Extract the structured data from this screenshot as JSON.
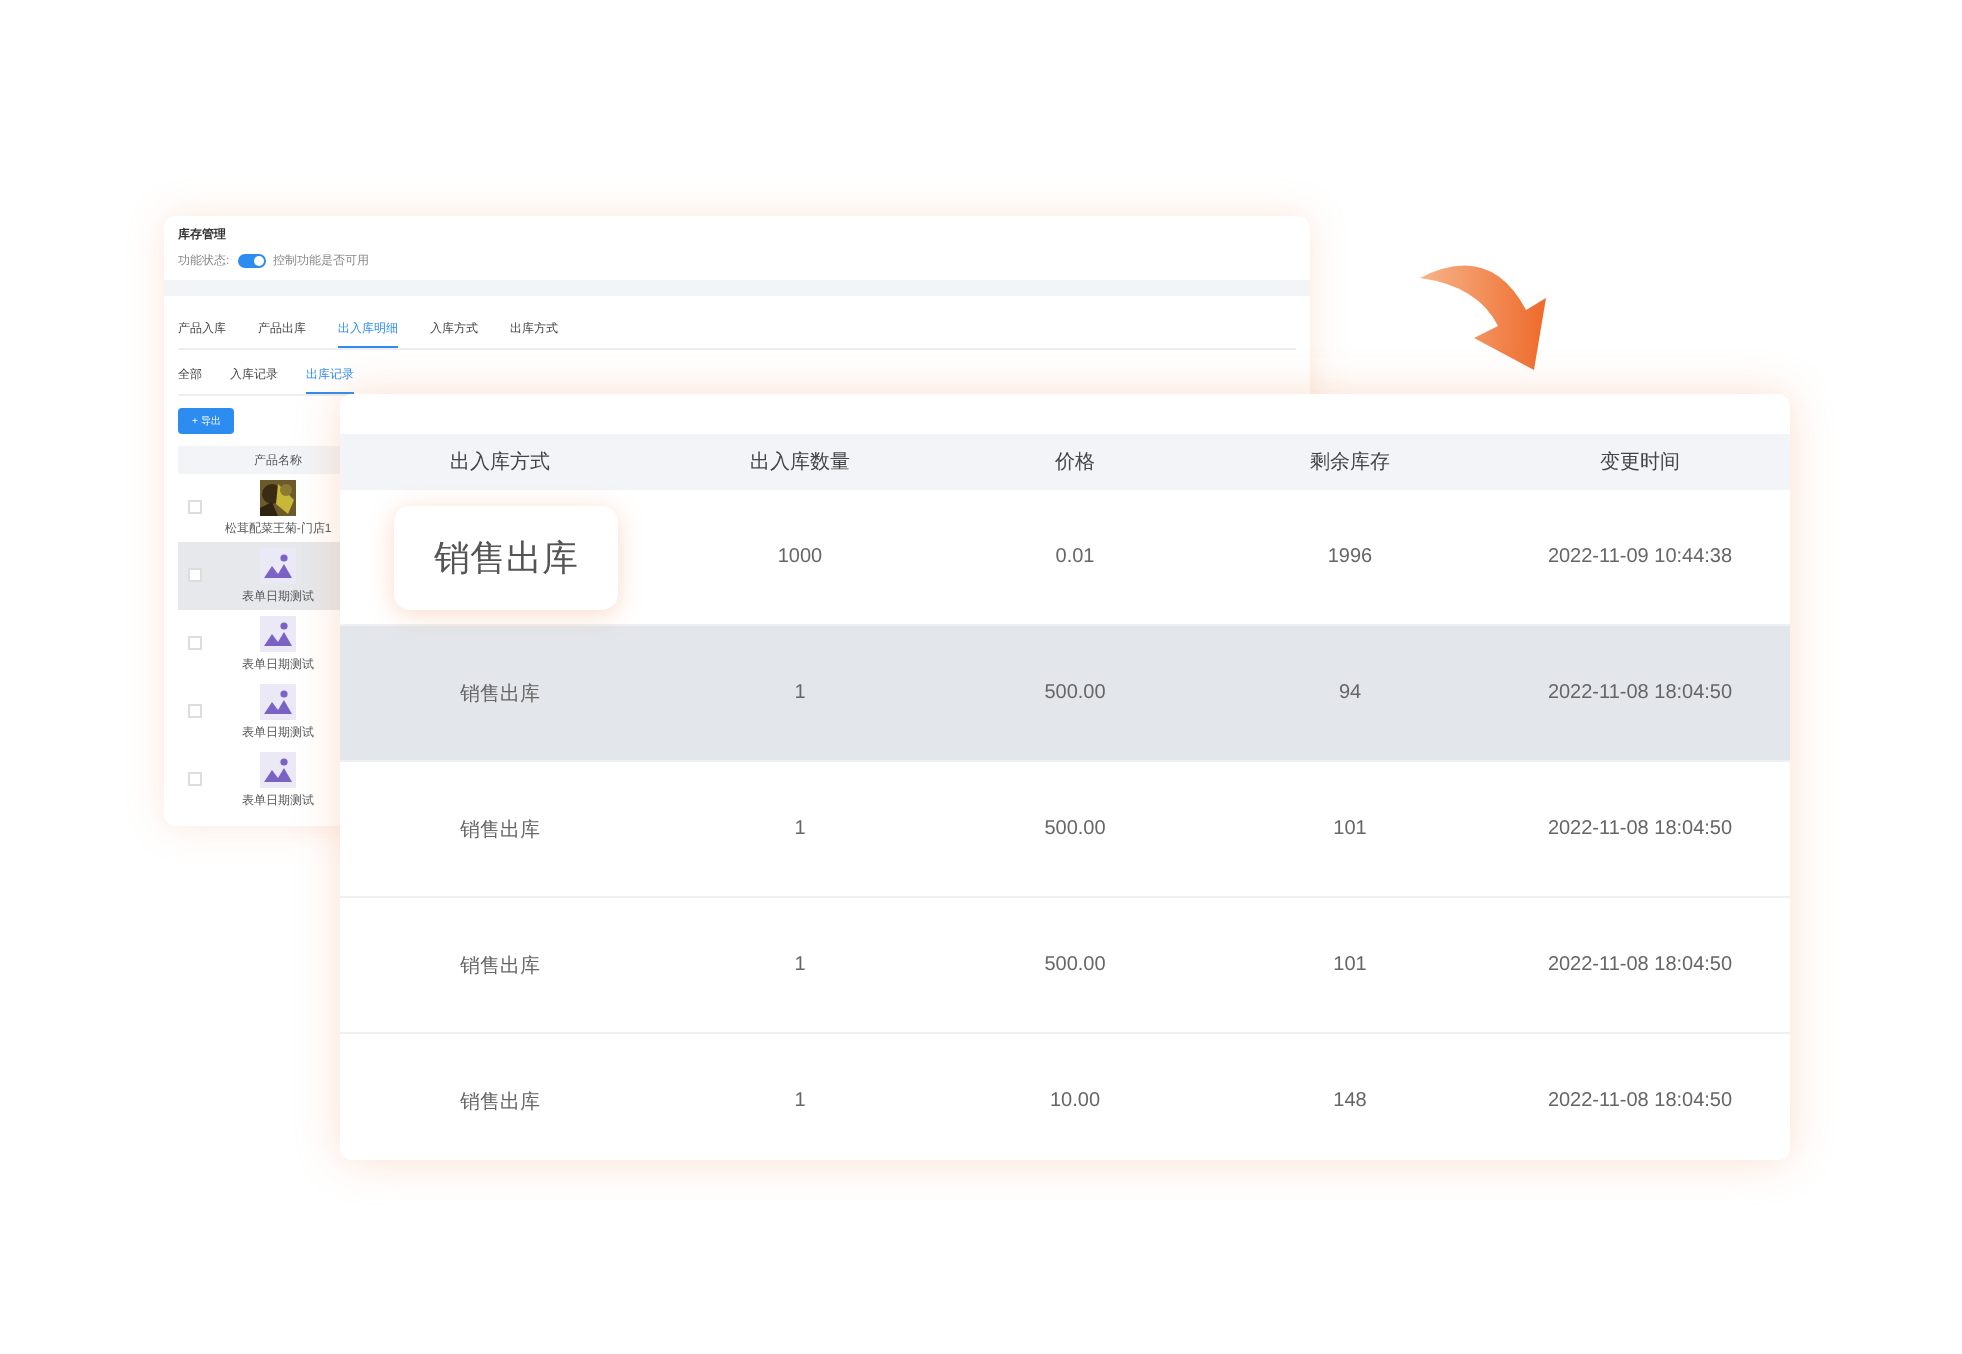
{
  "back_window": {
    "title": "库存管理",
    "status_label": "功能状态:",
    "status_on": true,
    "status_hint": "控制功能是否可用",
    "tabs": [
      {
        "label": "产品入库",
        "selected": false
      },
      {
        "label": "产品出库",
        "selected": false
      },
      {
        "label": "出入库明细",
        "selected": true
      },
      {
        "label": "入库方式",
        "selected": false
      },
      {
        "label": "出库方式",
        "selected": false
      }
    ],
    "subtabs": [
      {
        "label": "全部",
        "selected": false
      },
      {
        "label": "入库记录",
        "selected": false
      },
      {
        "label": "出库记录",
        "selected": true
      }
    ],
    "export_button": "+ 导出",
    "column": "产品名称",
    "rows": [
      {
        "name": "松茸配菜王菊-门店1",
        "highlighted": false
      },
      {
        "kind": "placeholder",
        "name": "表单日期测试",
        "highlighted": true
      },
      {
        "kind": "placeholder",
        "name": "表单日期测试",
        "highlighted": false
      },
      {
        "kind": "placeholder",
        "name": "表单日期测试",
        "highlighted": false
      },
      {
        "kind": "placeholder",
        "name": "表单日期测试",
        "highlighted": false
      }
    ]
  },
  "table": {
    "columns": [
      "出入库方式",
      "出入库数量",
      "价格",
      "剩余库存",
      "变更时间"
    ],
    "rows": [
      {
        "cells": [
          "销售出库",
          "1000",
          "0.01",
          "1996",
          "2022-11-09 10:44:38"
        ],
        "magnified": true,
        "highlighted": false
      },
      {
        "cells": [
          "销售出库",
          "1",
          "500.00",
          "94",
          "2022-11-08 18:04:50"
        ],
        "magnified": false,
        "highlighted": true
      },
      {
        "cells": [
          "销售出库",
          "1",
          "500.00",
          "101",
          "2022-11-08 18:04:50"
        ],
        "magnified": false,
        "highlighted": false
      },
      {
        "cells": [
          "销售出库",
          "1",
          "500.00",
          "101",
          "2022-11-08 18:04:50"
        ],
        "magnified": false,
        "highlighted": false
      },
      {
        "cells": [
          "销售出库",
          "1",
          "10.00",
          "148",
          "2022-11-08 18:04:50"
        ],
        "magnified": false,
        "highlighted": false
      }
    ]
  }
}
